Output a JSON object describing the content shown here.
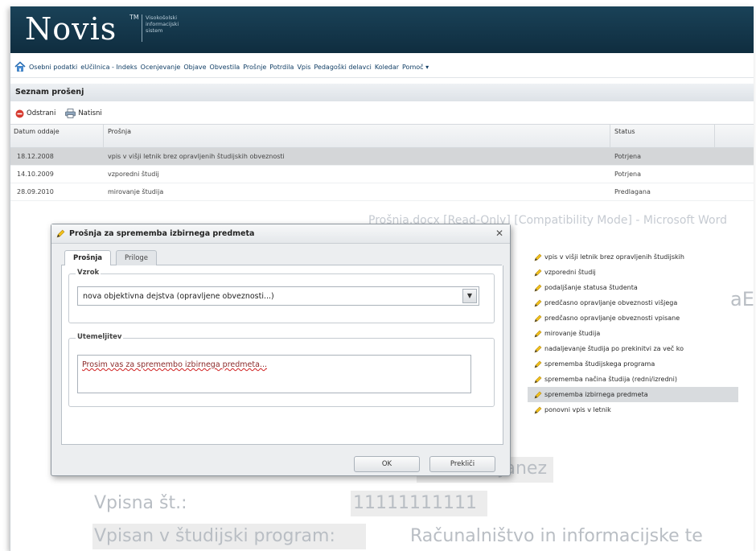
{
  "header": {
    "logo": "Novis",
    "tm": "TM",
    "subtitle_lines": [
      "Visokošolski",
      "informacijski",
      "sistem"
    ]
  },
  "menu": {
    "items": [
      "Osebni podatki",
      "eUčilnica - Indeks",
      "Ocenjevanje",
      "Objave",
      "Obvestila",
      "Prošnje",
      "Potrdila",
      "Vpis",
      "Pedagoški delavci",
      "Koledar",
      "Pomoč ▾"
    ]
  },
  "list": {
    "title": "Seznam prošenj",
    "toolbar": {
      "delete": "Odstrani",
      "print": "Natisni"
    },
    "columns": [
      "Datum oddaje",
      "Prošnja",
      "Status"
    ],
    "rows": [
      {
        "date": "18.12.2008",
        "request": "vpis v višji letnik brez opravljenih študijskih obveznosti",
        "status": "Potrjena"
      },
      {
        "date": "14.10.2009",
        "request": "vzporedni študij",
        "status": "Potrjena"
      },
      {
        "date": "28.09.2010",
        "request": "mirovanje študija",
        "status": "Predlagana"
      }
    ]
  },
  "background_doc": {
    "word_title": "Prošnja.docx [Read-Only] [Compatibility Mode] - Microsoft Word",
    "name_value": "Janez",
    "enroll_label": "Vpisna št.:",
    "enroll_value": "11111111111",
    "program_label": "Vpisan v študijski program:",
    "program_value": "Računalništvo in informacijske te",
    "fragment": "aE"
  },
  "dropdown": {
    "options": [
      "vpis v višji letnik brez opravljenih študijskih",
      "vzporedni študij",
      "podaljšanje statusa študenta",
      "predčasno opravljanje obveznosti višjega",
      "predčasno opravljanje obveznosti vpisane",
      "mirovanje študija",
      "nadaljevanje študija po prekinitvi za več ko",
      "sprememba študijskega programa",
      "sprememba načina študija (redni/izredni)",
      "sprememba izbirnega predmeta",
      "ponovni vpis v letnik"
    ],
    "selected_index": 9
  },
  "dialog": {
    "title": "Prošnja za sprememba izbirnega predmeta",
    "tabs": [
      "Prošnja",
      "Priloge"
    ],
    "reason_legend": "Vzrok",
    "reason_value": "nova objektivna dejstva (opravljene obveznosti...)",
    "justification_legend": "Utemeljitev",
    "justification_text": "Prosim vas za spremembo izbirnega predmeta...",
    "ok": "OK",
    "cancel": "Prekliči"
  }
}
